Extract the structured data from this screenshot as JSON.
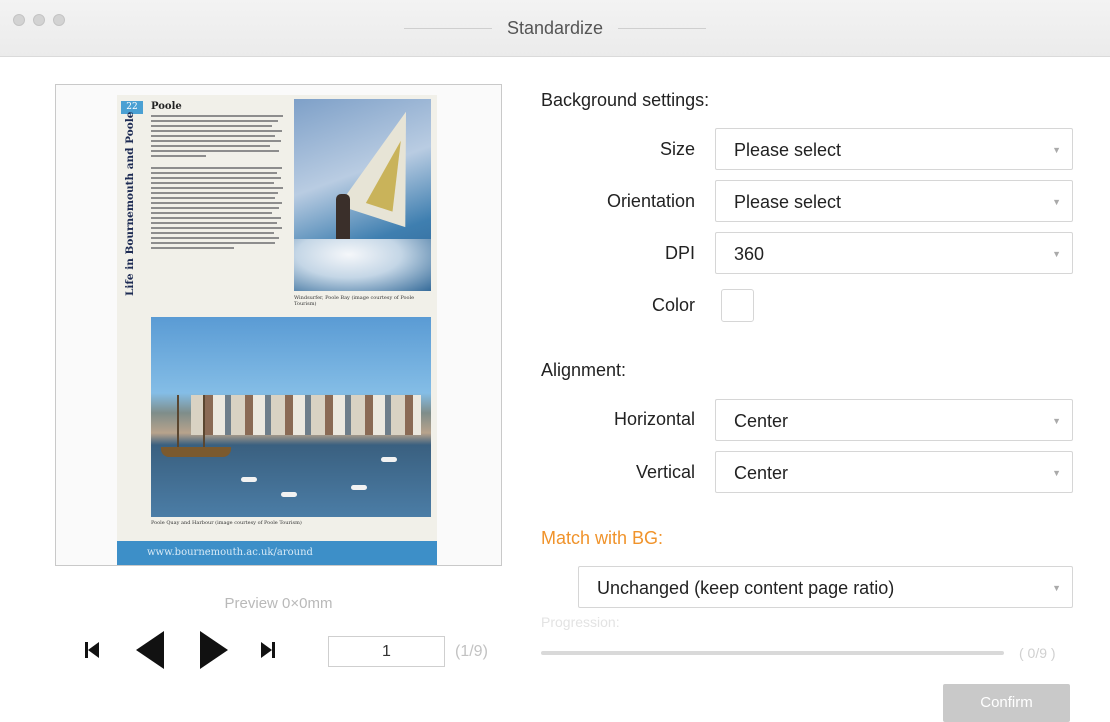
{
  "window": {
    "title": "Standardize"
  },
  "preview": {
    "page": {
      "number": "22",
      "vertical_title": "Life in Bournemouth and Poole",
      "heading": "Poole",
      "caption_surf": "Windsurfer, Poole Bay (image courtesy of Poole Tourism)",
      "caption_harbour": "Poole Quay and Harbour (image courtesy of Poole Tourism)",
      "footer": "www.bournemouth.ac.uk/around"
    },
    "label": "Preview  0×0mm",
    "nav": {
      "first_icon": "skip-first-icon",
      "prev_icon": "previous-triangle-icon",
      "next_icon": "next-triangle-icon",
      "last_icon": "skip-last-icon",
      "page_value": "1",
      "page_count": "(1/9)"
    }
  },
  "background_settings": {
    "heading": "Background settings:",
    "size": {
      "label": "Size",
      "value": "Please select"
    },
    "orientation": {
      "label": "Orientation",
      "value": "Please select"
    },
    "dpi": {
      "label": "DPI",
      "value": "360"
    },
    "color": {
      "label": "Color",
      "value": "#ffffff"
    }
  },
  "alignment": {
    "heading": "Alignment:",
    "horizontal": {
      "label": "Horizontal",
      "value": "Center"
    },
    "vertical": {
      "label": "Vertical",
      "value": "Center"
    }
  },
  "match": {
    "heading": "Match with BG:",
    "value": "Unchanged (keep content page ratio)"
  },
  "progress": {
    "label": "Progression:",
    "fraction": 0,
    "count": "( 0/9 )"
  },
  "actions": {
    "confirm_label": "Confirm"
  },
  "colors": {
    "accent_orange": "#f0932b",
    "disabled_gray": "#c9c9c9",
    "page_blue": "#3d8fc8"
  }
}
